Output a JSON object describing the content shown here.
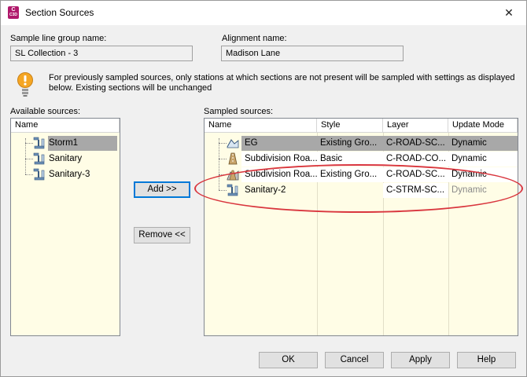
{
  "window": {
    "title": "Section Sources",
    "app_badge_top": "C",
    "app_badge_bottom": "C3D",
    "close_glyph": "✕"
  },
  "form": {
    "group_label": "Sample line group name:",
    "group_value": "SL Collection - 3",
    "alignment_label": "Alignment name:",
    "alignment_value": "Madison Lane"
  },
  "info": {
    "icon": "lightbulb-icon",
    "text": "For previously sampled sources, only stations at which sections are not present will be sampled with settings as displayed below. Existing sections will be unchanged"
  },
  "available": {
    "label": "Available sources:",
    "column": "Name",
    "items": [
      {
        "name": "Storm1",
        "icon": "pipe-network-icon",
        "selected": true
      },
      {
        "name": "Sanitary",
        "icon": "pipe-network-icon",
        "selected": false
      },
      {
        "name": "Sanitary-3",
        "icon": "pipe-network-icon",
        "selected": false
      }
    ]
  },
  "sampled": {
    "label": "Sampled sources:",
    "columns": [
      "Name",
      "Style",
      "Layer",
      "Update Mode"
    ],
    "rows": [
      {
        "name": "EG",
        "style": "Existing Gro...",
        "layer": "C-ROAD-SC...",
        "mode": "Dynamic",
        "icon": "surface-icon",
        "selected": true
      },
      {
        "name": "Subdivision Roa...",
        "style": "Basic",
        "layer": "C-ROAD-CO...",
        "mode": "Dynamic",
        "icon": "corridor-icon",
        "selected": false
      },
      {
        "name": "Subdivision Roa...",
        "style": "Existing Gro...",
        "layer": "C-ROAD-SC...",
        "mode": "Dynamic",
        "icon": "corridor-surface-icon",
        "selected": false
      },
      {
        "name": "Sanitary-2",
        "style": "",
        "layer": "C-STRM-SC...",
        "mode": "Dynamic",
        "icon": "pipe-network-icon",
        "selected": false,
        "mode_disabled": true
      }
    ]
  },
  "buttons": {
    "add": "Add >>",
    "remove": "Remove <<",
    "ok": "OK",
    "cancel": "Cancel",
    "apply": "Apply",
    "help": "Help"
  },
  "colors": {
    "panel_bg": "#fffde6",
    "selection": "#a8a8a8",
    "callout": "#d9363e",
    "app_badge": "#b0186b"
  }
}
